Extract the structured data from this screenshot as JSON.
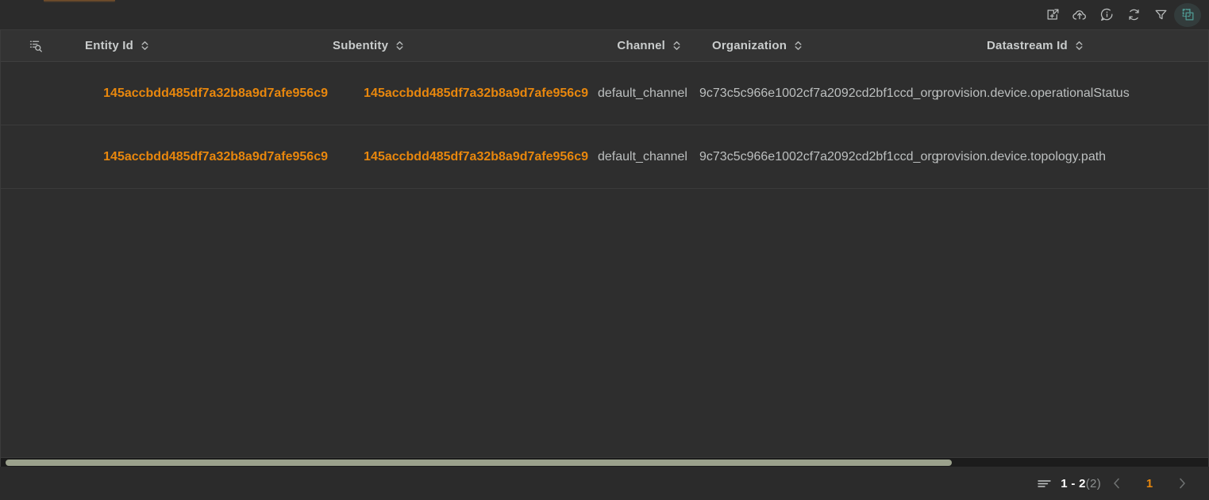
{
  "toolbar": {
    "actions": [
      {
        "name": "open-in-new-window-icon",
        "title": "Open in new window"
      },
      {
        "name": "cloud-upload-icon",
        "title": "Upload"
      },
      {
        "name": "info-circle-icon",
        "title": "Information"
      },
      {
        "name": "refresh-icon",
        "title": "Refresh"
      },
      {
        "name": "filter-funnel-icon",
        "title": "Filter"
      },
      {
        "name": "select-columns-icon",
        "title": "Columns",
        "active": true
      }
    ]
  },
  "table": {
    "search_icon": "search-list-icon",
    "columns": [
      {
        "label": "Entity Id",
        "sortable": true
      },
      {
        "label": "Subentity",
        "sortable": true
      },
      {
        "label": "Channel",
        "sortable": true
      },
      {
        "label": "Organization",
        "sortable": true
      },
      {
        "label": "Datastream Id",
        "sortable": true
      }
    ],
    "rows": [
      {
        "entity_id": "145accbdd485df7a32b8a9d7afe956c9",
        "subentity": "145accbdd485df7a32b8a9d7afe956c9",
        "channel": "default_channel",
        "organization": "9c73c5c966e1002cf7a2092cd2bf1ccd_org",
        "datastream_id": "provision.device.operationalStatus"
      },
      {
        "entity_id": "145accbdd485df7a32b8a9d7afe956c9",
        "subentity": "145accbdd485df7a32b8a9d7afe956c9",
        "channel": "default_channel",
        "organization": "9c73c5c966e1002cf7a2092cd2bf1ccd_org",
        "datastream_id": "provision.device.topology.path"
      }
    ]
  },
  "pagination": {
    "rows_icon": "rows-list-icon",
    "range": "1 - 2",
    "total": "(2)",
    "prev_label": "‹",
    "next_label": "›",
    "current_page": "1"
  },
  "colors": {
    "accent_orange": "#e8870d",
    "active_teal": "#4f9a93",
    "scrollbar": "#9ba18c",
    "background": "#2b2b2b",
    "table_background": "#2e2e2e",
    "header_background": "#333333"
  }
}
